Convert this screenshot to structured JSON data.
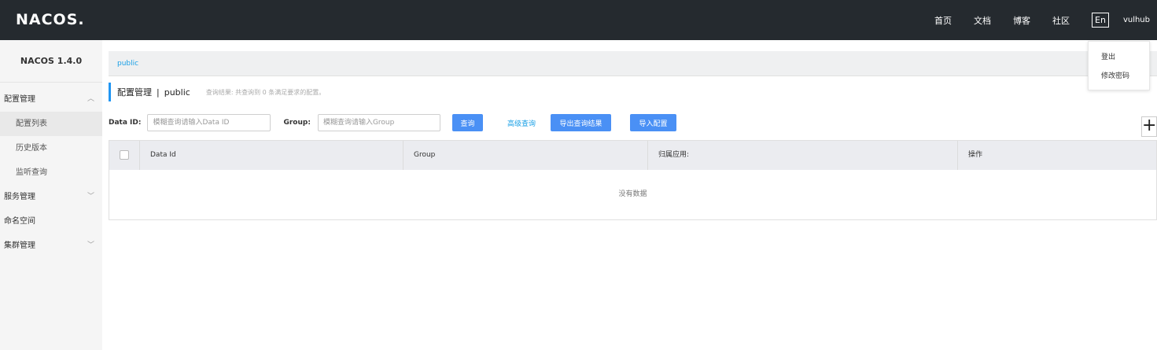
{
  "header": {
    "logo": "NACOS.",
    "nav": [
      "首页",
      "文档",
      "博客",
      "社区"
    ],
    "lang": "En",
    "user": "vulhub"
  },
  "user_menu": [
    "登出",
    "修改密码"
  ],
  "sidebar": {
    "version": "NACOS 1.4.0",
    "items": [
      {
        "label": "配置管理",
        "type": "group"
      },
      {
        "label": "配置列表",
        "type": "sub"
      },
      {
        "label": "历史版本",
        "type": "sub"
      },
      {
        "label": "监听查询",
        "type": "sub"
      },
      {
        "label": "服务管理",
        "type": "group"
      },
      {
        "label": "命名空间",
        "type": "group"
      },
      {
        "label": "集群管理",
        "type": "group"
      }
    ]
  },
  "breadcrumb": "public",
  "title": {
    "main": "配置管理",
    "separator": "|",
    "namespace": "public",
    "result": "查询结果: 共查询到 0 条满足要求的配置。"
  },
  "filter": {
    "data_id_label": "Data ID:",
    "data_id_placeholder": "模糊查询请输入Data ID",
    "group_label": "Group:",
    "group_placeholder": "模糊查询请输入Group",
    "query_button": "查询",
    "advanced_link": "高级查询",
    "export_button": "导出查询结果",
    "import_button": "导入配置"
  },
  "table": {
    "columns": [
      "Data Id",
      "Group",
      "归属应用:",
      "操作"
    ],
    "empty_text": "没有数据"
  }
}
